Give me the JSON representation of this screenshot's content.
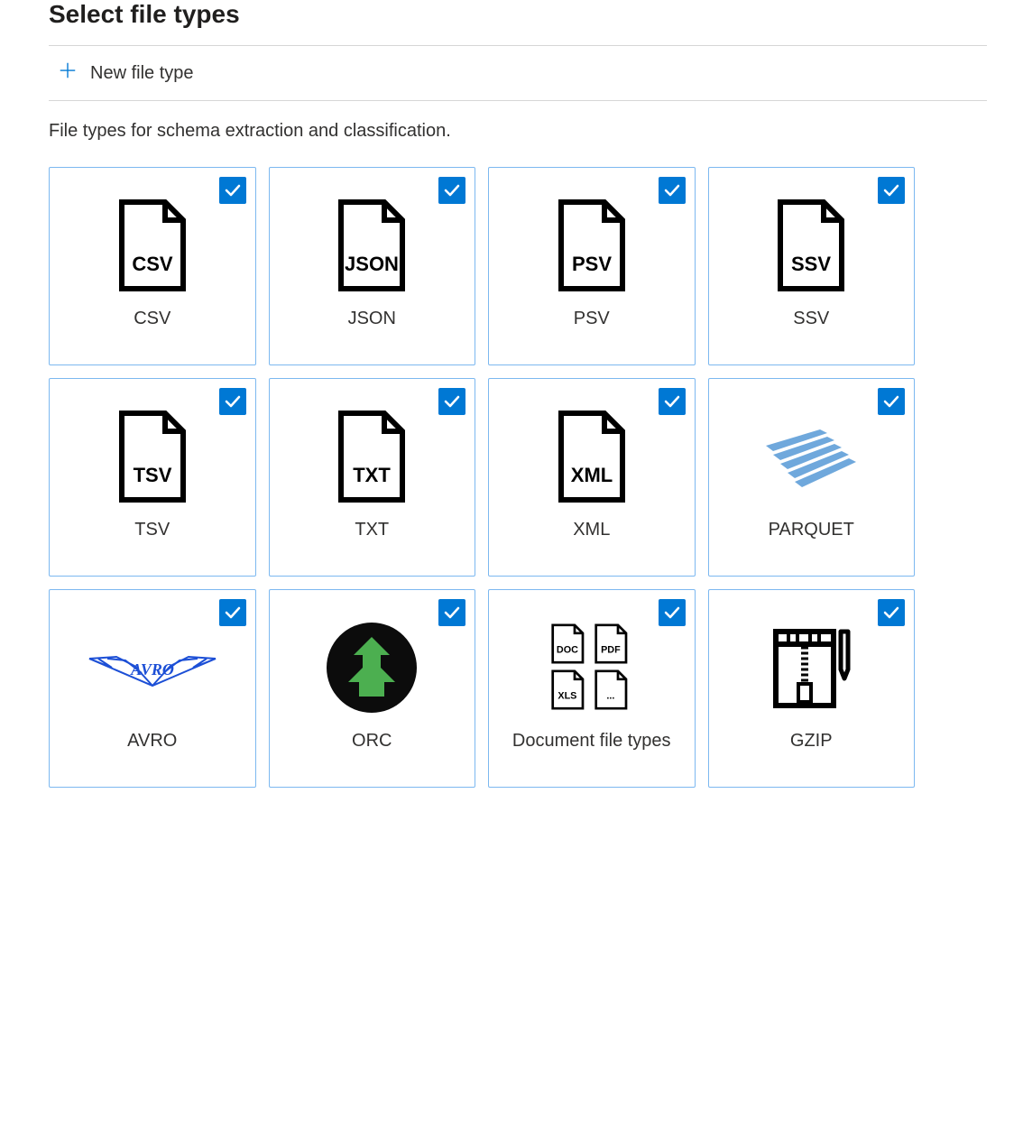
{
  "title": "Select file types",
  "new_file_type_label": "New file type",
  "description": "File types for schema extraction and classification.",
  "cards": [
    {
      "label": "CSV",
      "icon_text": "CSV",
      "kind": "file",
      "checked": true
    },
    {
      "label": "JSON",
      "icon_text": "JSON",
      "kind": "file",
      "checked": true
    },
    {
      "label": "PSV",
      "icon_text": "PSV",
      "kind": "file",
      "checked": true
    },
    {
      "label": "SSV",
      "icon_text": "SSV",
      "kind": "file",
      "checked": true
    },
    {
      "label": "TSV",
      "icon_text": "TSV",
      "kind": "file",
      "checked": true
    },
    {
      "label": "TXT",
      "icon_text": "TXT",
      "kind": "file",
      "checked": true
    },
    {
      "label": "XML",
      "icon_text": "XML",
      "kind": "file",
      "checked": true
    },
    {
      "label": "PARQUET",
      "icon_text": "",
      "kind": "parquet",
      "checked": true
    },
    {
      "label": "AVRO",
      "icon_text": "",
      "kind": "avro",
      "checked": true
    },
    {
      "label": "ORC",
      "icon_text": "",
      "kind": "orc",
      "checked": true
    },
    {
      "label": "Document file types",
      "icon_text": "",
      "kind": "docgroup",
      "checked": true
    },
    {
      "label": "GZIP",
      "icon_text": "",
      "kind": "gzip",
      "checked": true
    }
  ],
  "docgroup_labels": {
    "doc": "DOC",
    "pdf": "PDF",
    "xls": "XLS",
    "more": "..."
  }
}
